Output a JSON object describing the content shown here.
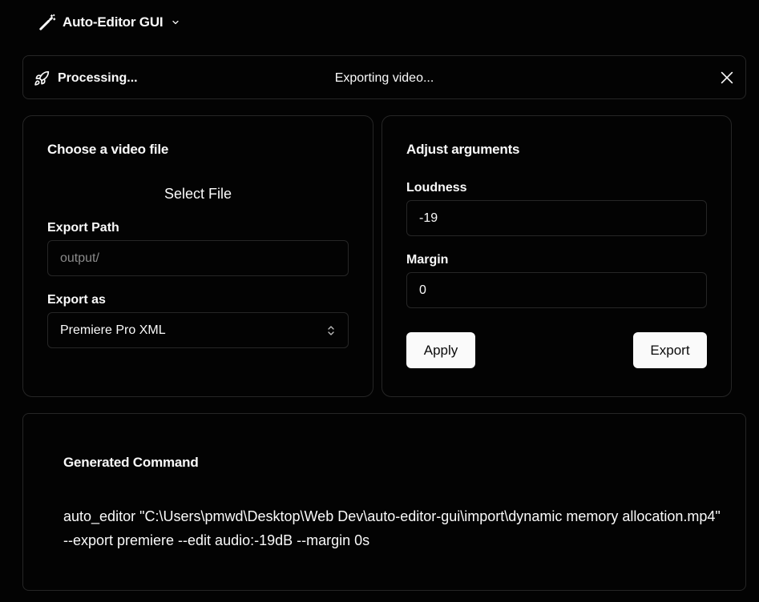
{
  "header": {
    "app_title": "Auto-Editor GUI",
    "wand_icon": "magic-wand-icon",
    "chevron_icon": "chevron-down-icon"
  },
  "toast": {
    "icon": "rocket-icon",
    "title": "Processing...",
    "message": "Exporting video...",
    "close_icon": "close-icon"
  },
  "file_card": {
    "heading": "Choose a video file",
    "select_file_label": "Select File",
    "export_path_label": "Export Path",
    "export_path_placeholder": "output/",
    "export_as_label": "Export as",
    "export_as_value": "Premiere Pro XML",
    "select_icon": "chevrons-up-down-icon"
  },
  "args_card": {
    "heading": "Adjust arguments",
    "loudness_label": "Loudness",
    "loudness_value": "-19",
    "margin_label": "Margin",
    "margin_value": "0",
    "apply_label": "Apply",
    "export_label": "Export"
  },
  "command_card": {
    "heading": "Generated Command",
    "command": "auto_editor \"C:\\Users\\pmwd\\Desktop\\Web Dev\\auto-editor-gui\\import\\dynamic memory allocation.mp4\" --export premiere --edit audio:-19dB --margin 0s"
  },
  "colors": {
    "background": "#030303",
    "border": "#262626",
    "foreground": "#fafafa",
    "muted": "#8a8a8a",
    "button_bg": "#fafafa",
    "button_fg": "#0a0a0a"
  }
}
